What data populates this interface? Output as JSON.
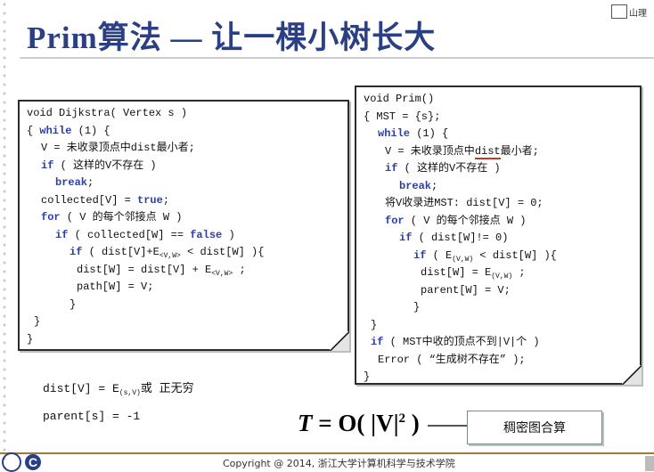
{
  "title": "Prim算法 — 让一棵小树长大",
  "top_right_mark": "山理",
  "dijkstra": {
    "lines": [
      {
        "indent": 0,
        "parts": [
          {
            "t": "void"
          },
          {
            "t": " Dijkstra( Vertex s )"
          }
        ]
      },
      {
        "indent": 0,
        "parts": [
          {
            "t": "{ "
          },
          {
            "t": "while",
            "kw": true
          },
          {
            "t": " (1) {"
          }
        ]
      },
      {
        "indent": 2,
        "parts": [
          {
            "t": "V = 未收录顶点中dist最小者;"
          }
        ]
      },
      {
        "indent": 2,
        "parts": [
          {
            "t": "if",
            "kw": true
          },
          {
            "t": " ( 这样的V不存在 )"
          }
        ]
      },
      {
        "indent": 4,
        "parts": [
          {
            "t": "break",
            "kw": true
          },
          {
            "t": ";"
          }
        ]
      },
      {
        "indent": 2,
        "parts": [
          {
            "t": "collected[V] = "
          },
          {
            "t": "true",
            "kw": true
          },
          {
            "t": ";"
          }
        ]
      },
      {
        "indent": 2,
        "parts": [
          {
            "t": "for",
            "kw": true
          },
          {
            "t": " ( V 的每个邻接点 W )"
          }
        ]
      },
      {
        "indent": 4,
        "parts": [
          {
            "t": "if",
            "kw": true
          },
          {
            "t": " ( collected[W] == "
          },
          {
            "t": "false",
            "kw": true
          },
          {
            "t": " )"
          }
        ]
      },
      {
        "indent": 6,
        "parts": [
          {
            "t": "if",
            "kw": true
          },
          {
            "t": " ( dist[V]+E"
          },
          {
            "t": "<V,W>",
            "sub": true
          },
          {
            "t": " < dist[W] ){"
          }
        ]
      },
      {
        "indent": 7,
        "parts": [
          {
            "t": "dist[W] = dist[V] + E"
          },
          {
            "t": "<V,W>",
            "sub": true
          },
          {
            "t": " ;"
          }
        ]
      },
      {
        "indent": 7,
        "parts": [
          {
            "t": "path[W] = V;"
          }
        ]
      },
      {
        "indent": 6,
        "parts": [
          {
            "t": "}"
          }
        ]
      },
      {
        "indent": 1,
        "parts": [
          {
            "t": "}"
          }
        ]
      },
      {
        "indent": 0,
        "parts": [
          {
            "t": "}"
          }
        ]
      }
    ]
  },
  "prim": {
    "lines": [
      {
        "indent": 0,
        "parts": [
          {
            "t": "void Prim()"
          }
        ]
      },
      {
        "indent": 0,
        "parts": [
          {
            "t": "{ MST = {s};"
          }
        ]
      },
      {
        "indent": 2,
        "parts": [
          {
            "t": "while",
            "kw": true
          },
          {
            "t": " (1) {"
          }
        ]
      },
      {
        "indent": 3,
        "parts": [
          {
            "t": "V = 未收录顶点中"
          },
          {
            "t": "dist",
            "underline": true
          },
          {
            "t": "最小者;"
          }
        ]
      },
      {
        "indent": 3,
        "parts": [
          {
            "t": "if",
            "kw": true
          },
          {
            "t": " ( 这样的V不存在 )"
          }
        ]
      },
      {
        "indent": 5,
        "parts": [
          {
            "t": "break",
            "kw": true
          },
          {
            "t": ";"
          }
        ]
      },
      {
        "indent": 3,
        "parts": [
          {
            "t": "将V收录进MST: dist[V] = 0;"
          }
        ]
      },
      {
        "indent": 3,
        "parts": [
          {
            "t": "for",
            "kw": true
          },
          {
            "t": " ( V 的每个邻接点 W )"
          }
        ]
      },
      {
        "indent": 5,
        "parts": [
          {
            "t": "if",
            "kw": true
          },
          {
            "t": " ( dist[W]!= 0)"
          }
        ]
      },
      {
        "indent": 7,
        "parts": [
          {
            "t": "if",
            "kw": true
          },
          {
            "t": " ( E"
          },
          {
            "t": "(V,W)",
            "sub": true
          },
          {
            "t": " < dist[W] ){"
          }
        ]
      },
      {
        "indent": 8,
        "parts": [
          {
            "t": "dist[W] = E"
          },
          {
            "t": "(V,W)",
            "sub": true
          },
          {
            "t": " ;"
          }
        ]
      },
      {
        "indent": 8,
        "parts": [
          {
            "t": "parent[W] = V;"
          }
        ]
      },
      {
        "indent": 7,
        "parts": [
          {
            "t": "}"
          }
        ]
      },
      {
        "indent": 1,
        "parts": [
          {
            "t": "}"
          }
        ]
      },
      {
        "indent": 1,
        "parts": [
          {
            "t": "if",
            "kw": true
          },
          {
            "t": " ( MST中收的顶点不到|V|个 )"
          }
        ]
      },
      {
        "indent": 2,
        "parts": [
          {
            "t": "Error ( “生成树不存在” );"
          }
        ]
      },
      {
        "indent": 0,
        "parts": [
          {
            "t": "}"
          }
        ]
      }
    ]
  },
  "notes": {
    "line1_prefix": "dist[V] = E",
    "line1_sub": "(s,V)",
    "line1_suffix": "或 正无穷",
    "line2": "parent[s] = -1"
  },
  "formula": {
    "T": "T",
    "eq": " = O( |V|",
    "exp": "2",
    "close": " )"
  },
  "dense_label": "稠密图合算",
  "copyright": "Copyright @ 2014, 浙江大学计算机科学与技术学院",
  "logo_c": "C",
  "colors": {
    "title": "#2a3f84",
    "keyword": "#2a3fa8",
    "underline": "#c0392b"
  }
}
